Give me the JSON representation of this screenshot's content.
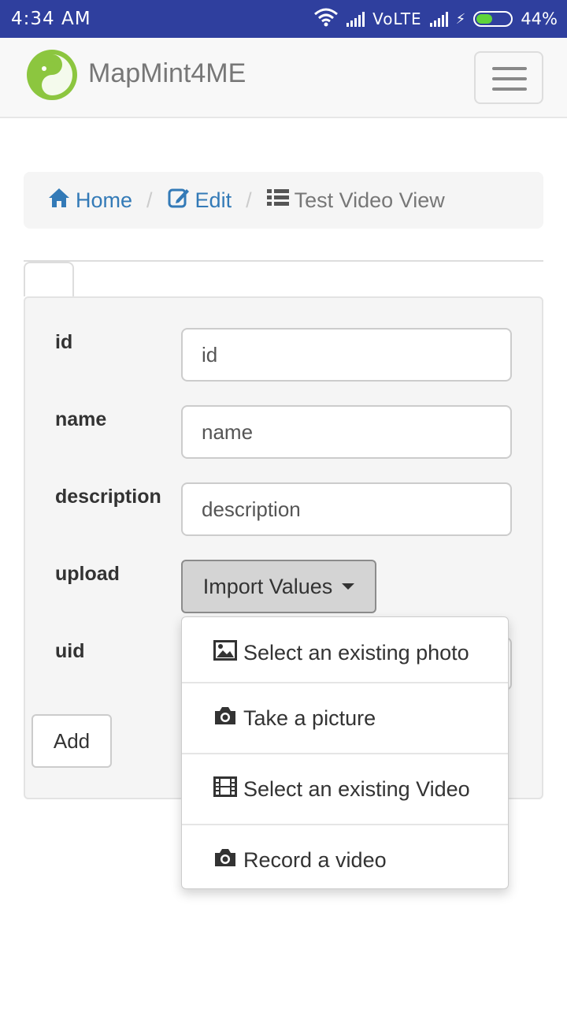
{
  "status_bar": {
    "time": "4:34 AM",
    "network": "VoLTE",
    "battery": "44%"
  },
  "navbar": {
    "brand": "MapMint4ME",
    "logo_icon": "mapmint-logo-icon",
    "menu_icon": "hamburger-menu-icon"
  },
  "breadcrumb": {
    "items": [
      {
        "label": "Home",
        "icon": "home-icon"
      },
      {
        "label": "Edit",
        "icon": "edit-icon"
      },
      {
        "label": "Test Video View",
        "icon": "list-icon"
      }
    ]
  },
  "form": {
    "fields": [
      {
        "label": "id",
        "placeholder": "id"
      },
      {
        "label": "name",
        "placeholder": "name"
      },
      {
        "label": "description",
        "placeholder": "description"
      },
      {
        "label": "upload"
      },
      {
        "label": "uid"
      }
    ],
    "import_button": "Import Values",
    "add_button": "Add"
  },
  "dropdown": {
    "items": [
      {
        "label": "Select an existing photo",
        "icon": "picture-icon"
      },
      {
        "label": "Take a picture",
        "icon": "camera-icon"
      },
      {
        "label": "Select an existing Video",
        "icon": "film-icon"
      },
      {
        "label": "Record a video",
        "icon": "camera-icon"
      }
    ]
  },
  "colors": {
    "status_bar": "#2f3f9e",
    "link": "#337ab7",
    "logo_green": "#8cc63f"
  }
}
